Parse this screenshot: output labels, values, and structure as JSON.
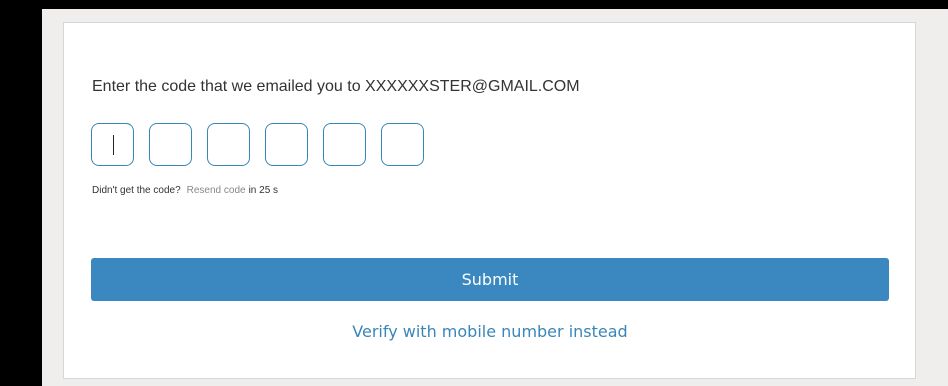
{
  "verify": {
    "prompt": "Enter the code that we emailed you to XXXXXXSTER@GMAIL.COM",
    "code_digits": [
      "",
      "",
      "",
      "",
      "",
      ""
    ],
    "resend_question": "Didn't get the code?",
    "resend_link": "Resend code",
    "resend_timer": "in 25 s",
    "submit_label": "Submit",
    "alt_link": "Verify with mobile number instead"
  },
  "colors": {
    "accent": "#3a88bf",
    "background": "#efeeec",
    "card": "#ffffff"
  }
}
